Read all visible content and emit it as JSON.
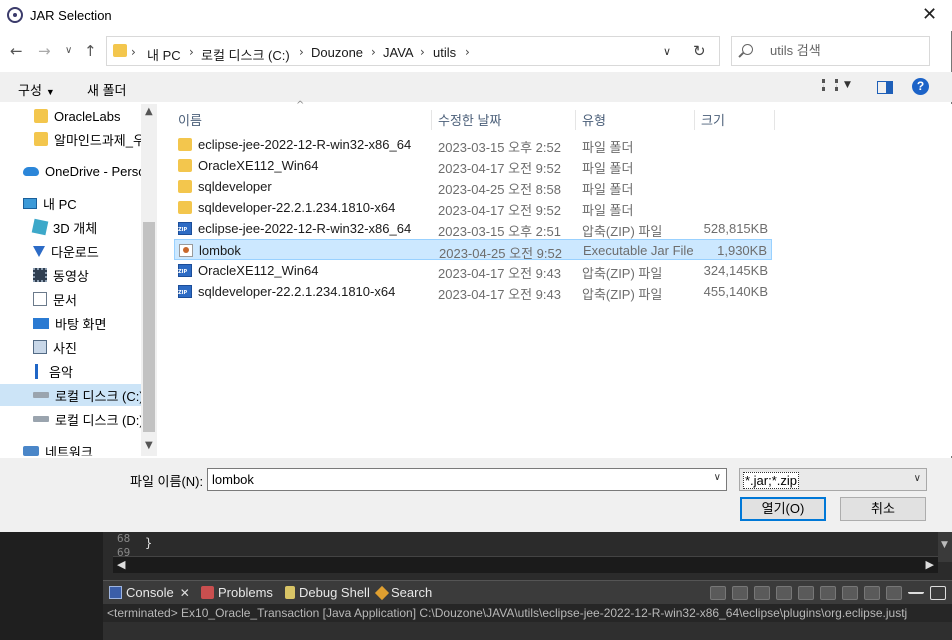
{
  "dialog": {
    "title": "JAR Selection"
  },
  "address": {
    "crumbs": [
      "내 PC",
      "로컬 디스크 (C:)",
      "Douzone",
      "JAVA",
      "utils"
    ],
    "search_placeholder": "utils 검색"
  },
  "toolbar": {
    "organize_label": "구성",
    "new_folder_label": "새 폴더"
  },
  "nav": {
    "items": [
      {
        "label": "OracleLabs",
        "icon": "folder-icon"
      },
      {
        "label": "알마인드과제_우",
        "icon": "folder-icon"
      },
      {
        "label": "OneDrive - Persor",
        "icon": "cloud-icon"
      },
      {
        "label": "내 PC",
        "icon": "pc-icon"
      },
      {
        "label": "3D 개체",
        "icon": "cube-icon"
      },
      {
        "label": "다운로드",
        "icon": "download-icon"
      },
      {
        "label": "동영상",
        "icon": "video-icon"
      },
      {
        "label": "문서",
        "icon": "document-icon"
      },
      {
        "label": "바탕 화면",
        "icon": "desktop-icon"
      },
      {
        "label": "사진",
        "icon": "picture-icon"
      },
      {
        "label": "음악",
        "icon": "music-icon"
      },
      {
        "label": "로컬 디스크 (C:)",
        "icon": "drive-icon",
        "selected": true
      },
      {
        "label": "로컬 디스크 (D:)",
        "icon": "drive-icon"
      },
      {
        "label": "네트워크",
        "icon": "network-icon"
      }
    ]
  },
  "filelist": {
    "columns": {
      "name": "이름",
      "date": "수정한 날짜",
      "type": "유형",
      "size": "크기"
    },
    "rows": [
      {
        "name": "eclipse-jee-2022-12-R-win32-x86_64",
        "date": "2023-03-15 오후 2:52",
        "type": "파일 폴더",
        "size": "",
        "icon": "folder-icon"
      },
      {
        "name": "OracleXE112_Win64",
        "date": "2023-04-17 오전 9:52",
        "type": "파일 폴더",
        "size": "",
        "icon": "folder-icon"
      },
      {
        "name": "sqldeveloper",
        "date": "2023-04-25 오전 8:58",
        "type": "파일 폴더",
        "size": "",
        "icon": "folder-icon"
      },
      {
        "name": "sqldeveloper-22.2.1.234.1810-x64",
        "date": "2023-04-17 오전 9:52",
        "type": "파일 폴더",
        "size": "",
        "icon": "folder-icon"
      },
      {
        "name": "eclipse-jee-2022-12-R-win32-x86_64",
        "date": "2023-03-15 오후 2:51",
        "type": "압축(ZIP) 파일",
        "size": "528,815KB",
        "icon": "zip-icon"
      },
      {
        "name": "lombok",
        "date": "2023-04-25 오전 9:52",
        "type": "Executable Jar File",
        "size": "1,930KB",
        "icon": "jar-icon",
        "selected": true
      },
      {
        "name": "OracleXE112_Win64",
        "date": "2023-04-17 오전 9:43",
        "type": "압축(ZIP) 파일",
        "size": "324,145KB",
        "icon": "zip-icon"
      },
      {
        "name": "sqldeveloper-22.2.1.234.1810-x64",
        "date": "2023-04-17 오전 9:43",
        "type": "압축(ZIP) 파일",
        "size": "455,140KB",
        "icon": "zip-icon"
      }
    ]
  },
  "bottom": {
    "filename_label": "파일 이름(N):",
    "filename_value": "lombok",
    "filter_value": "*.jar;*.zip",
    "open_label": "열기(O)",
    "cancel_label": "취소"
  },
  "eclipse": {
    "line_numbers": [
      "68",
      "69"
    ],
    "brace": "}",
    "tabs": [
      "Console",
      "Problems",
      "Debug Shell",
      "Search"
    ],
    "console_text": "<terminated> Ex10_Oracle_Transaction [Java Application] C:\\Douzone\\JAVA\\utils\\eclipse-jee-2022-12-R-win32-x86_64\\eclipse\\plugins\\org.eclipse.justj"
  }
}
